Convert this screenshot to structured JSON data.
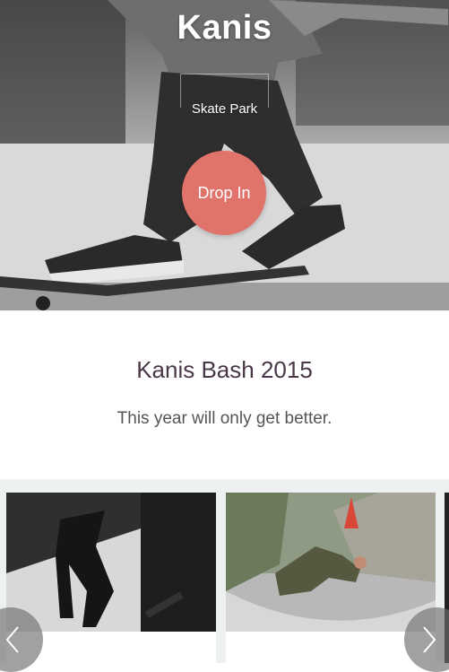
{
  "hero": {
    "title": "Kanis",
    "subtitle": "Skate Park",
    "cta_label": "Drop In"
  },
  "event": {
    "title": "Kanis Bash 2015",
    "description": "This year will only get better."
  },
  "gallery": {
    "items": [
      {
        "image": "skater-on-ramp-bw-photo"
      },
      {
        "image": "skater-in-bowl-graffiti-photo"
      },
      {
        "image": "partial-photo"
      }
    ],
    "prev_icon": "chevron-left-icon",
    "next_icon": "chevron-right-icon"
  }
}
